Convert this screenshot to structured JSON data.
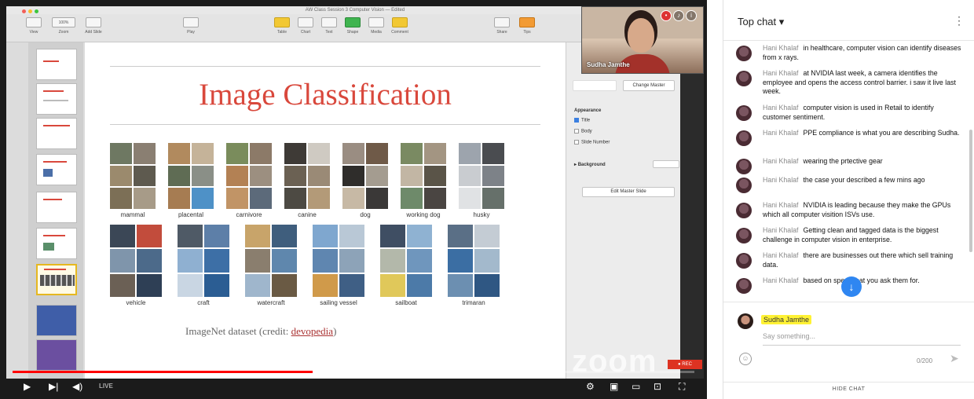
{
  "window": {
    "title": "AW Class Session 3 Computer Vision — Edited"
  },
  "toolbar": {
    "items": [
      "View",
      "Zoom",
      "Add Slide",
      "Play",
      "Table",
      "Chart",
      "Text",
      "Shape",
      "Media",
      "Comment",
      "Share",
      "Tips"
    ],
    "zoom_value": "100%"
  },
  "slide": {
    "title": "Image Classification",
    "row1_labels": [
      "mammal",
      "placental",
      "carnivore",
      "canine",
      "dog",
      "working dog",
      "husky"
    ],
    "row2_labels": [
      "vehicle",
      "craft",
      "watercraft",
      "sailing vessel",
      "sailboat",
      "trimaran"
    ],
    "credit_prefix": "ImageNet dataset (credit: ",
    "credit_link": "devopedia",
    "credit_suffix": ")",
    "colors": {
      "title": "#d9483c"
    }
  },
  "inspector": {
    "change_master": "Change Master",
    "appearance": "Appearance",
    "options": [
      {
        "label": "Title",
        "checked": true
      },
      {
        "label": "Body",
        "checked": false
      },
      {
        "label": "Slide Number",
        "checked": false
      }
    ],
    "background": "Background",
    "edit_master": "Edit Master Slide"
  },
  "camera": {
    "name": "Sudha Jamthe"
  },
  "overlay": {
    "zoom_watermark": "zoom"
  },
  "player": {
    "live_label": "LIVE",
    "progress": 0.44,
    "accent": "#ff0000"
  },
  "chat": {
    "header": "Top chat",
    "messages": [
      {
        "author": "Hani Khalaf",
        "text": "in healthcare, computer vision can identify diseases from x rays."
      },
      {
        "author": "Hani Khalaf",
        "text": "at NVIDIA last week, a camera identifies the employee and opens the access control barrier. i saw it live last week."
      },
      {
        "author": "Hani Khalaf",
        "text": "computer vision is used in Retail to identify customer sentiment."
      },
      {
        "author": "Hani Khalaf",
        "text": "PPE compliance is what you are describing Sudha."
      },
      {
        "author": "Hani Khalaf",
        "text": "wearing the prtective gear"
      },
      {
        "author": "Hani Khalaf",
        "text": "the case your described a few mins ago"
      },
      {
        "author": "Hani Khalaf",
        "text": "NVIDIA is leading because they make the GPUs which all computer visition ISVs use."
      },
      {
        "author": "Hani Khalaf",
        "text": "Getting clean and tagged data is the biggest challenge in computer vision in enterprise."
      },
      {
        "author": "Hani Khalaf",
        "text": "there are businesses out there which sell training data."
      },
      {
        "author": "Hani Khalaf",
        "text": "based on specs that you ask them for."
      }
    ],
    "current_user": "Sudha Jamthe",
    "placeholder": "Say something...",
    "counter": "0/200",
    "hide_chat": "HIDE CHAT"
  }
}
